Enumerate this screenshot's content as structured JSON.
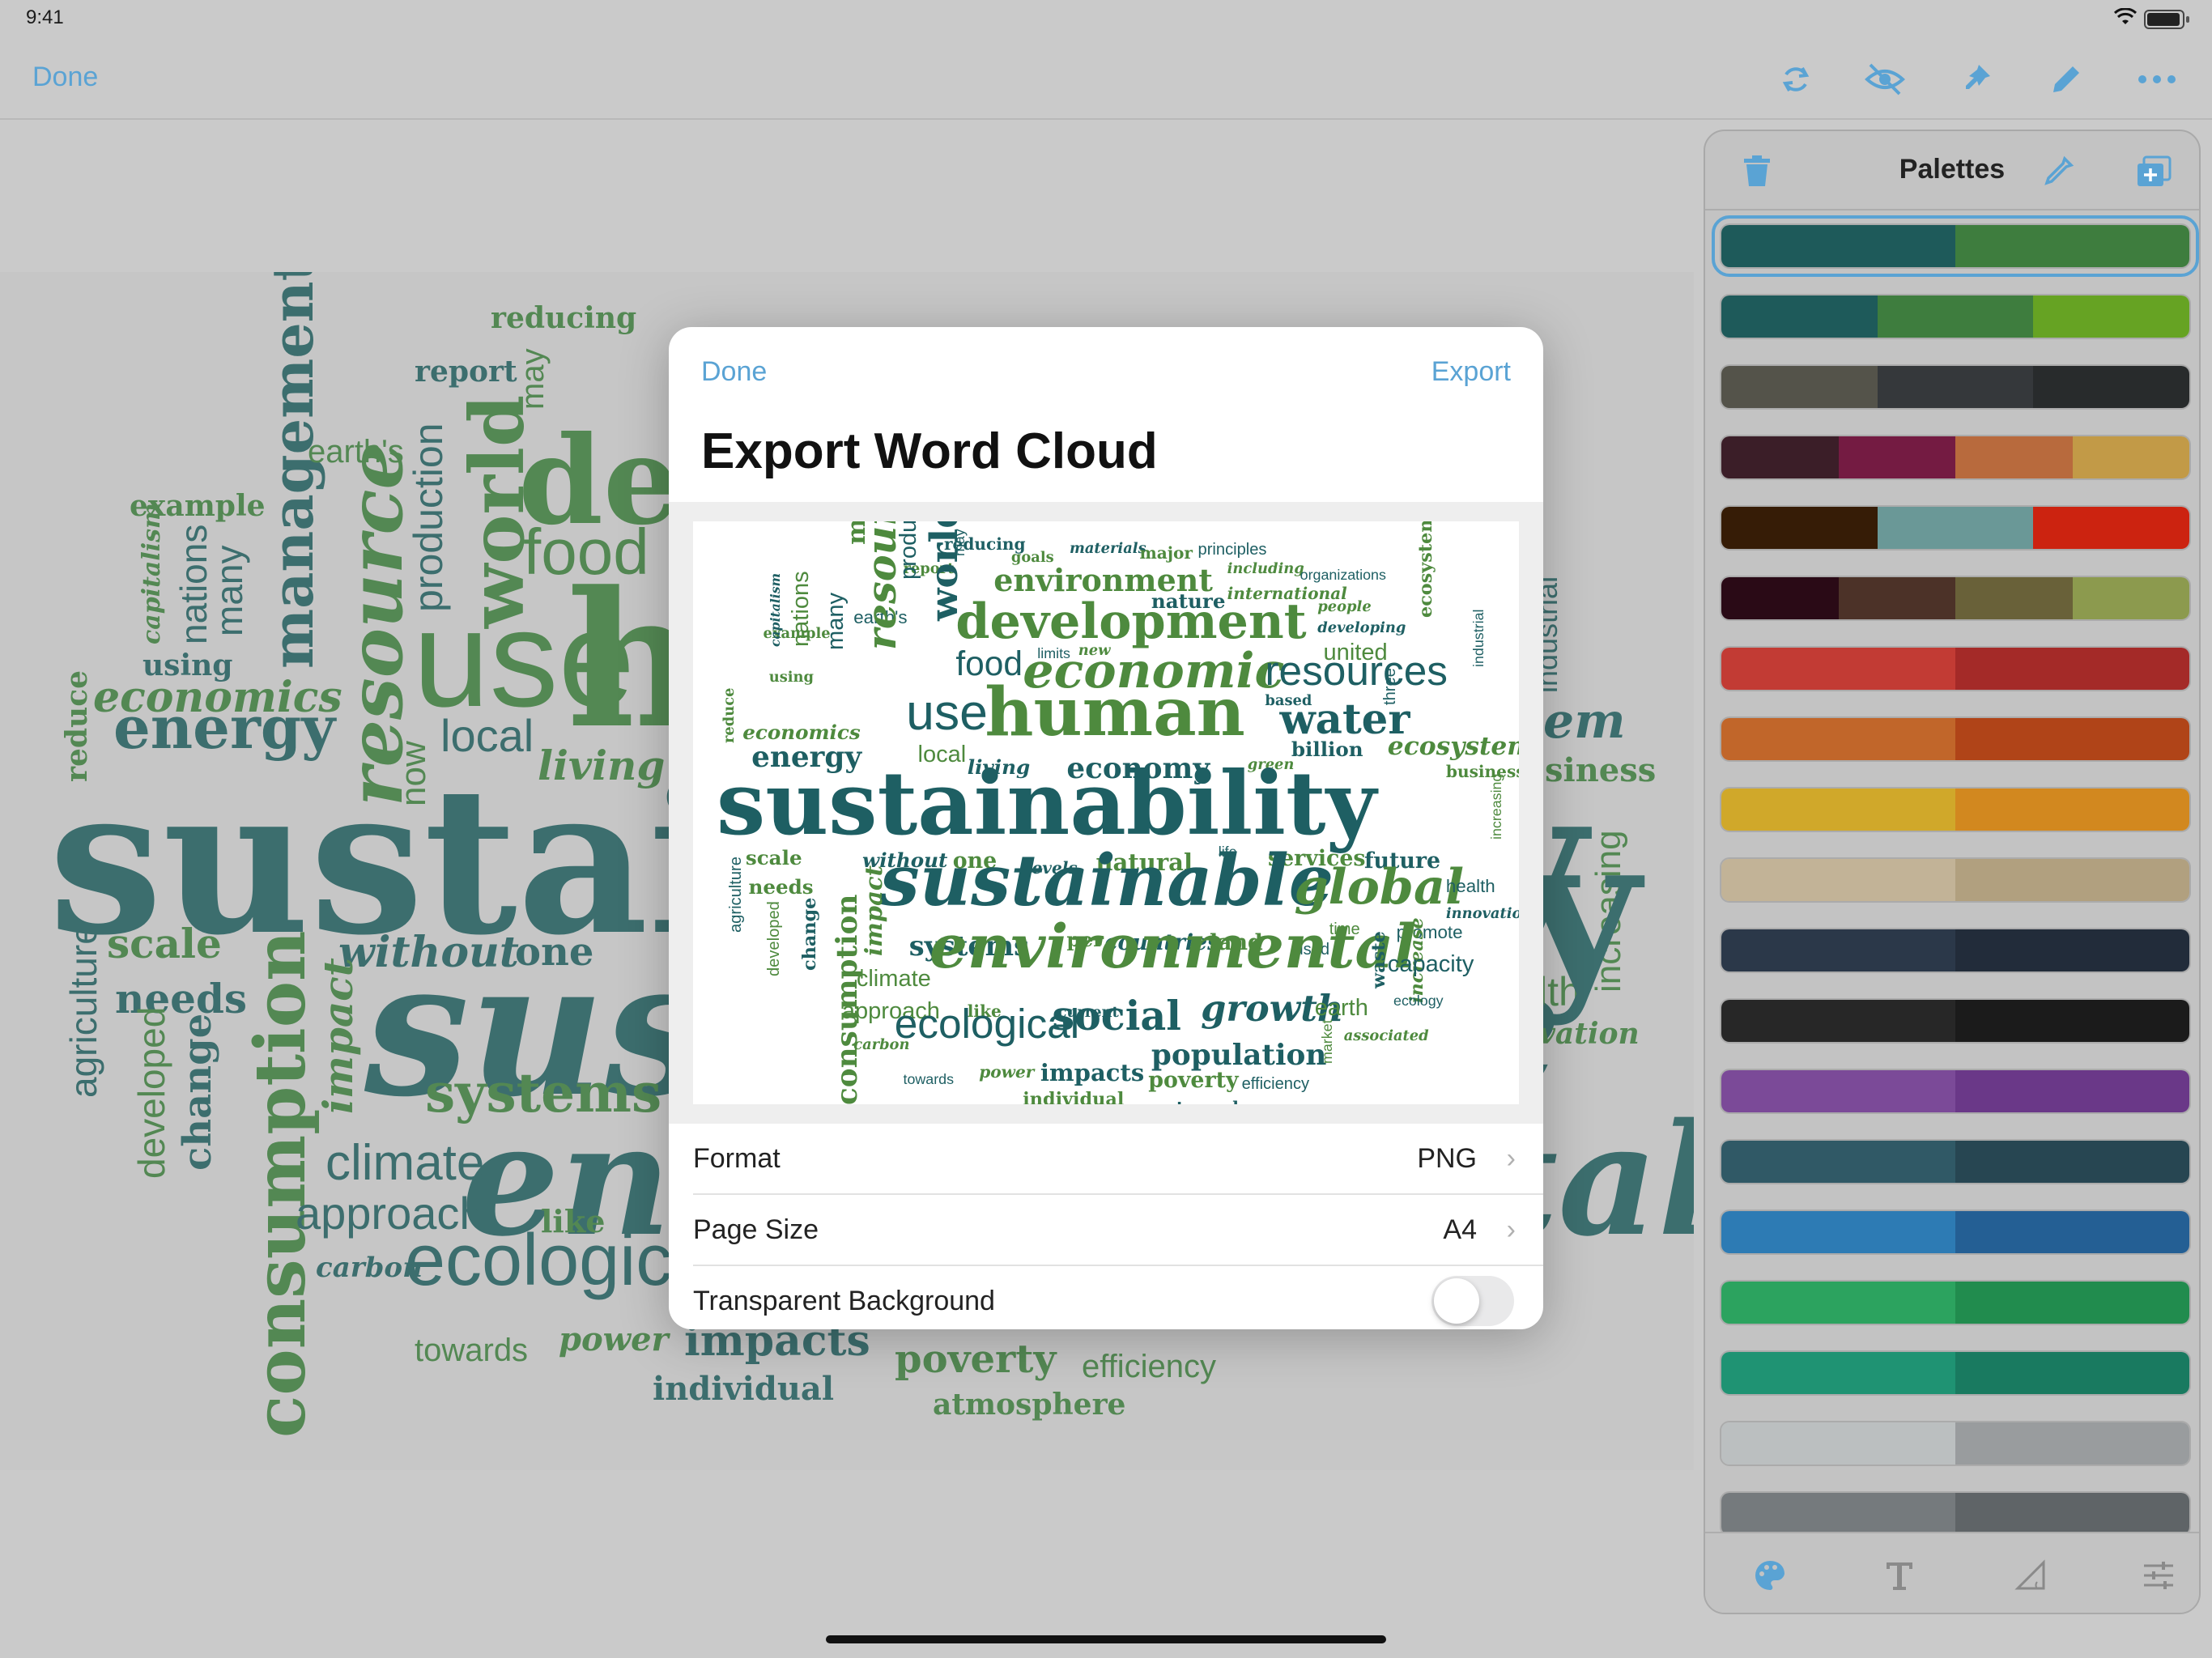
{
  "status_bar": {
    "time": "9:41"
  },
  "navbar": {
    "done_label": "Done",
    "icons": [
      "refresh-icon",
      "visibility-off-icon",
      "pin-icon",
      "pencil-icon",
      "more-icon"
    ]
  },
  "background_cloud": [
    {
      "text": "sustainability",
      "color": "#1e5a5a"
    },
    {
      "text": "sustainable",
      "color": "#1e5a5a"
    },
    {
      "text": "environmental",
      "color": "#1e5a5a"
    },
    {
      "text": "human",
      "color": "#3a7a3a"
    },
    {
      "text": "development",
      "color": "#3a7a3a"
    },
    {
      "text": "use",
      "color": "#3a7a3a"
    },
    {
      "text": "resource",
      "color": "#3a7a3a"
    },
    {
      "text": "world",
      "color": "#3a7a3a"
    },
    {
      "text": "management",
      "color": "#1e5a5a"
    },
    {
      "text": "consumption",
      "color": "#3a7a3a"
    },
    {
      "text": "energy",
      "color": "#1e5a5a"
    },
    {
      "text": "economics",
      "color": "#3a7a3a"
    },
    {
      "text": "ecological",
      "color": "#1e5a5a"
    },
    {
      "text": "systems",
      "color": "#3a7a3a"
    },
    {
      "text": "climate",
      "color": "#1e5a5a"
    },
    {
      "text": "approach",
      "color": "#1e5a5a"
    },
    {
      "text": "impacts",
      "color": "#1e5a5a"
    },
    {
      "text": "poverty",
      "color": "#3a7a3a"
    },
    {
      "text": "efficiency",
      "color": "#3a7a3a"
    },
    {
      "text": "atmosphere",
      "color": "#3a7a3a"
    },
    {
      "text": "individual",
      "color": "#1e5a5a"
    },
    {
      "text": "towards",
      "color": "#3a7a3a"
    },
    {
      "text": "power",
      "color": "#3a7a3a"
    },
    {
      "text": "carbon",
      "color": "#1e5a5a"
    },
    {
      "text": "like",
      "color": "#3a7a3a"
    },
    {
      "text": "without",
      "color": "#1e5a5a"
    },
    {
      "text": "one",
      "color": "#1e5a5a"
    },
    {
      "text": "scale",
      "color": "#3a7a3a"
    },
    {
      "text": "needs",
      "color": "#1e5a5a"
    },
    {
      "text": "change",
      "color": "#1e5a5a"
    },
    {
      "text": "developed",
      "color": "#3a7a3a"
    },
    {
      "text": "agriculture",
      "color": "#1e5a5a"
    },
    {
      "text": "impact",
      "color": "#3a7a3a"
    },
    {
      "text": "reduce",
      "color": "#3a7a3a"
    },
    {
      "text": "using",
      "color": "#1e5a5a"
    },
    {
      "text": "example",
      "color": "#3a7a3a"
    },
    {
      "text": "capitalism",
      "color": "#3a7a3a"
    },
    {
      "text": "nations",
      "color": "#1e5a5a"
    },
    {
      "text": "many",
      "color": "#1e5a5a"
    },
    {
      "text": "earth's",
      "color": "#3a7a3a"
    },
    {
      "text": "production",
      "color": "#1e5a5a"
    },
    {
      "text": "food",
      "color": "#3a7a3a"
    },
    {
      "text": "local",
      "color": "#1e5a5a"
    },
    {
      "text": "living",
      "color": "#3a7a3a"
    },
    {
      "text": "now",
      "color": "#3a7a3a"
    },
    {
      "text": "report",
      "color": "#1e5a5a"
    },
    {
      "text": "reducing",
      "color": "#3a7a3a"
    },
    {
      "text": "may",
      "color": "#3a7a3a"
    },
    {
      "text": "increasing",
      "color": "#3a7a3a"
    },
    {
      "text": "industrial",
      "color": "#1e5a5a"
    },
    {
      "text": "em",
      "color": "#1e5a5a"
    },
    {
      "text": "siness",
      "color": "#3a7a3a"
    },
    {
      "text": "lth",
      "color": "#3a7a3a"
    },
    {
      "text": "vation",
      "color": "#3a7a3a"
    }
  ],
  "panel": {
    "title": "Palettes",
    "header_icons": [
      "trash-icon",
      "eyedropper-icon",
      "add-palette-icon"
    ],
    "palettes": [
      {
        "colors": [
          "#1e5a5a",
          "#3e7d3e"
        ],
        "selected": true
      },
      {
        "colors": [
          "#1e5a5a",
          "#3e7d3e",
          "#66a323"
        ]
      },
      {
        "colors": [
          "#54534a",
          "#35383b",
          "#282b2c"
        ]
      },
      {
        "colors": [
          "#3b1e28",
          "#741b42",
          "#b86a3d",
          "#c29a47"
        ]
      },
      {
        "colors": [
          "#361c06",
          "#6a9897",
          "#cc2310"
        ]
      },
      {
        "colors": [
          "#2a0a16",
          "#4c3228",
          "#696139",
          "#8c9a4e"
        ]
      },
      {
        "colors": [
          "#c23b34",
          "#a42a28"
        ]
      },
      {
        "colors": [
          "#c1662a",
          "#b04418"
        ]
      },
      {
        "colors": [
          "#d0a82a",
          "#d2881f"
        ]
      },
      {
        "colors": [
          "#c2b397",
          "#b1a07f"
        ]
      },
      {
        "colors": [
          "#2b3849",
          "#222c3a"
        ]
      },
      {
        "colors": [
          "#272727",
          "#1b1b1b"
        ]
      },
      {
        "colors": [
          "#7b4a98",
          "#6a3888"
        ]
      },
      {
        "colors": [
          "#305966",
          "#274652"
        ]
      },
      {
        "colors": [
          "#2d7bb4",
          "#245f94"
        ]
      },
      {
        "colors": [
          "#2ca35f",
          "#218c4e"
        ]
      },
      {
        "colors": [
          "#1f9373",
          "#197a60"
        ]
      },
      {
        "colors": [
          "#bbbfc0",
          "#999c9e"
        ]
      },
      {
        "colors": [
          "#757a7d",
          "#5f6467"
        ]
      }
    ],
    "tab_icons": [
      "palette-icon",
      "text-icon",
      "shape-icon",
      "sliders-icon"
    ]
  },
  "modal": {
    "done_label": "Done",
    "export_label": "Export",
    "title": "Export Word Cloud",
    "preview_words": [
      "reducing",
      "goals",
      "materials",
      "major",
      "principles",
      "report",
      "may",
      "including",
      "organizations",
      "environment",
      "nature",
      "international",
      "earth's",
      "people",
      "world",
      "development",
      "developing",
      "example",
      "food",
      "economic",
      "resources",
      "united",
      "limits",
      "new",
      "capitalism",
      "nations",
      "many",
      "management",
      "production",
      "resource",
      "based",
      "using",
      "use",
      "human",
      "water",
      "ecosystems",
      "industrial",
      "economics",
      "three",
      "reduce",
      "energy",
      "local",
      "billion",
      "ecosystem",
      "living",
      "green",
      "economy",
      "business",
      "sustainability",
      "scale",
      "without",
      "one",
      "levels",
      "natural",
      "life",
      "services",
      "future",
      "needs",
      "sustainable",
      "global",
      "health",
      "increasing",
      "agriculture",
      "impact",
      "innovation",
      "time",
      "promote",
      "developed",
      "change",
      "consumption",
      "systems",
      "per",
      "countries",
      "land",
      "used",
      "environmental",
      "waste",
      "increase",
      "capacity",
      "climate",
      "ecology",
      "approach",
      "current",
      "like",
      "growth",
      "earth",
      "social",
      "carbon",
      "ecological",
      "associated",
      "population",
      "market",
      "towards",
      "power",
      "impacts",
      "poverty",
      "efficiency",
      "individual",
      "atmosphere"
    ],
    "rows": [
      {
        "label": "Format",
        "value": "PNG"
      },
      {
        "label": "Page Size",
        "value": "A4"
      },
      {
        "label": "Transparent Background",
        "toggle": false
      }
    ]
  }
}
